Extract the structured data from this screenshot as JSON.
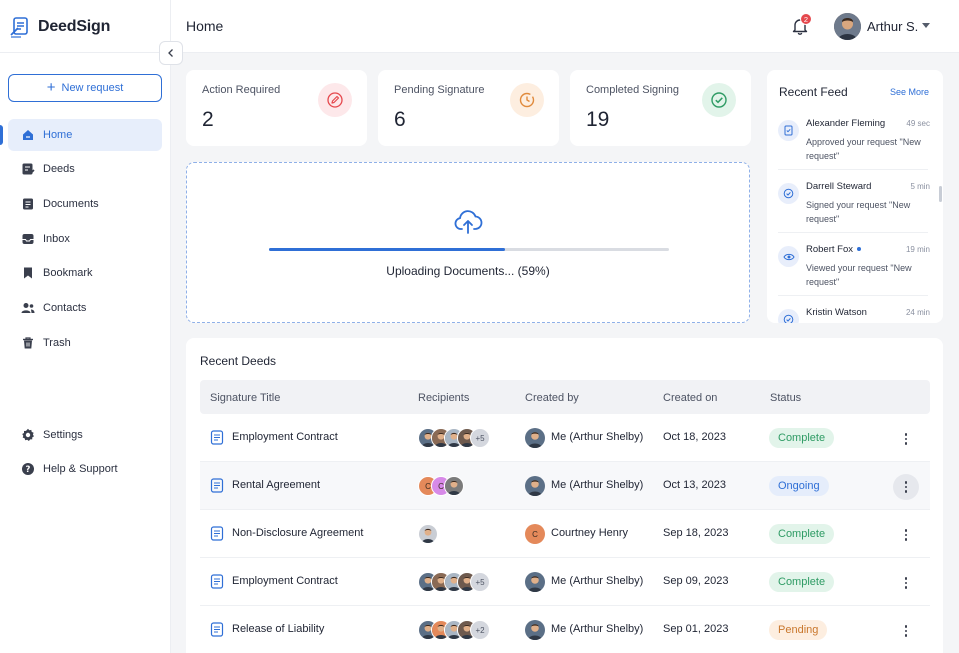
{
  "app": {
    "name": "DeedSign"
  },
  "sidebar": {
    "new_request": "New request",
    "items": [
      {
        "label": "Home",
        "icon": "home-icon",
        "active": true
      },
      {
        "label": "Deeds",
        "icon": "deeds-icon"
      },
      {
        "label": "Documents",
        "icon": "documents-icon"
      },
      {
        "label": "Inbox",
        "icon": "inbox-icon"
      },
      {
        "label": "Bookmark",
        "icon": "bookmark-icon"
      },
      {
        "label": "Contacts",
        "icon": "contacts-icon"
      },
      {
        "label": "Trash",
        "icon": "trash-icon"
      }
    ],
    "bottom_items": [
      {
        "label": "Settings",
        "icon": "gear-icon"
      },
      {
        "label": "Help & Support",
        "icon": "help-icon"
      }
    ]
  },
  "header": {
    "title": "Home",
    "notification_count": "2",
    "user_name": "Arthur S."
  },
  "stats": [
    {
      "label": "Action Required",
      "value": "2",
      "icon": "edit-icon",
      "color": "#e5484d",
      "bg": "#fde8ea"
    },
    {
      "label": "Pending Signature",
      "value": "6",
      "icon": "clock-icon",
      "color": "#e08a3c",
      "bg": "#fdeee0"
    },
    {
      "label": "Completed Signing",
      "value": "19",
      "icon": "check-circle-icon",
      "color": "#2e9b64",
      "bg": "#e2f4ea"
    }
  ],
  "upload": {
    "text": "Uploading Documents... (59%)",
    "progress": 0.59
  },
  "feed": {
    "title": "Recent Feed",
    "see_more": "See More",
    "items": [
      {
        "name": "Alexander Fleming",
        "time": "49 sec",
        "desc": "Approved your request \"New request\"",
        "icon": "document-icon"
      },
      {
        "name": "Darrell Steward",
        "time": "5 min",
        "desc": "Signed your request \"New request\"",
        "icon": "check-circle-icon"
      },
      {
        "name": "Robert Fox",
        "time": "19 min",
        "desc": "Viewed your request \"New request\"",
        "icon": "eye-icon",
        "unread": true
      },
      {
        "name": "Kristin Watson",
        "time": "24 min",
        "desc": "",
        "icon": "check-circle-icon"
      }
    ]
  },
  "deeds": {
    "title": "Recent Deeds",
    "columns": [
      "Signature Title",
      "Recipients",
      "Created by",
      "Created on",
      "Status"
    ],
    "rows": [
      {
        "title": "Employment Contract",
        "recipients_more": "+5",
        "created_by": "Me (Arthur Shelby)",
        "created_on": "Oct 18, 2023",
        "status": "Complete"
      },
      {
        "title": "Rental Agreement",
        "recipients_more": "",
        "created_by": "Me (Arthur Shelby)",
        "created_on": "Oct 13, 2023",
        "status": "Ongoing"
      },
      {
        "title": "Non-Disclosure Agreement",
        "recipients_more": "",
        "created_by": "Courtney Henry",
        "created_on": "Sep 18, 2023",
        "status": "Complete"
      },
      {
        "title": "Employment Contract",
        "recipients_more": "+5",
        "created_by": "Me (Arthur Shelby)",
        "created_on": "Sep 09, 2023",
        "status": "Complete"
      },
      {
        "title": "Release of Liability",
        "recipients_more": "+2",
        "created_by": "Me (Arthur Shelby)",
        "created_on": "Sep 01, 2023",
        "status": "Pending"
      }
    ],
    "status_colors": {
      "Complete": {
        "fg": "#2e9b64",
        "bg": "#e2f4ea"
      },
      "Ongoing": {
        "fg": "#2f6fd6",
        "bg": "#e5edfb"
      },
      "Pending": {
        "fg": "#c9772c",
        "bg": "#fdeee0"
      }
    }
  },
  "avatar_initials": {
    "c": "C"
  }
}
